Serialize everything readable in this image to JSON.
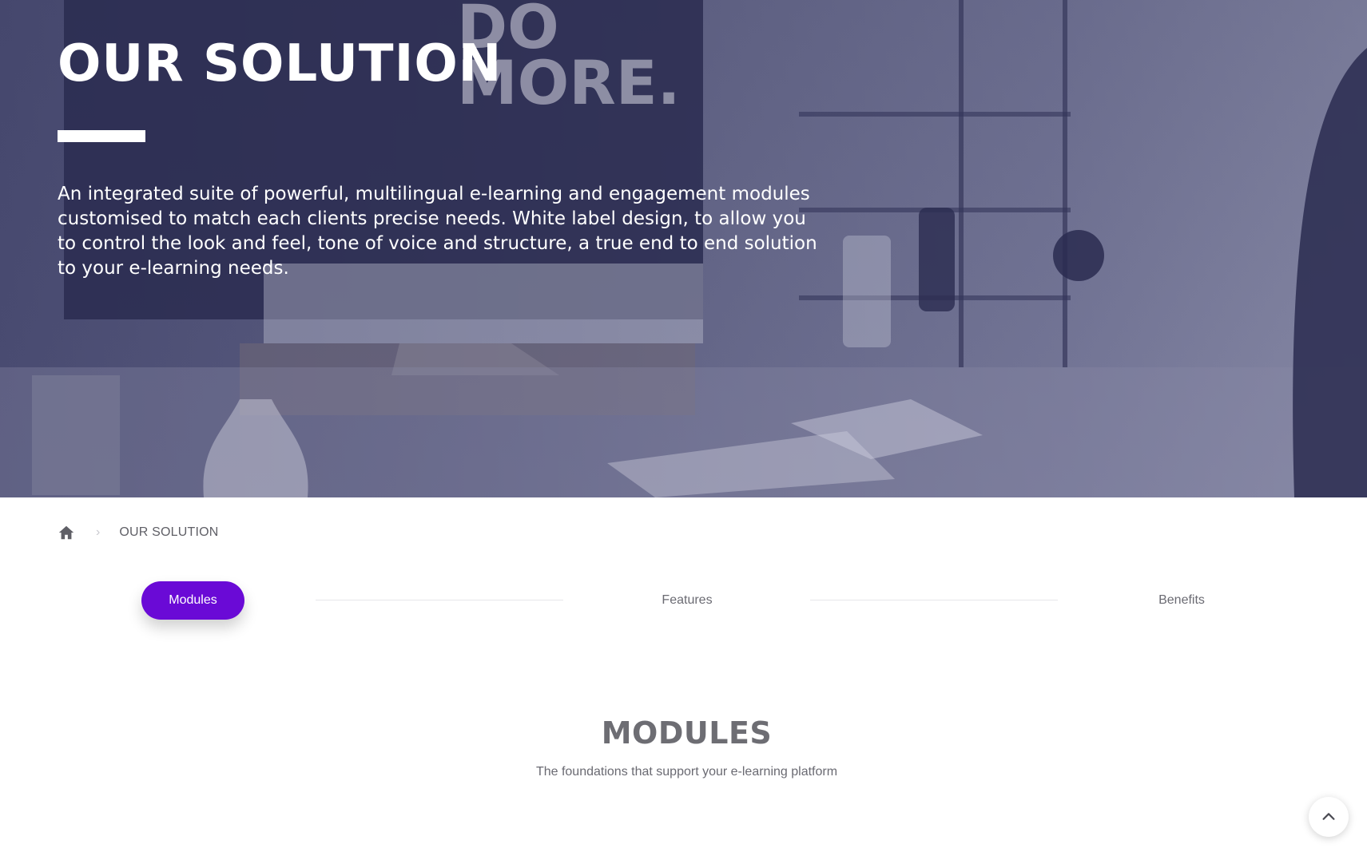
{
  "hero": {
    "title": "OUR SOLUTION",
    "description": "An integrated suite of powerful, multilingual e-learning and engagement modules customised to match each clients precise needs. White label design, to allow you to control the look and feel, tone of voice and structure, a true end to end solution to your e-learning needs.",
    "poster_text": "DO MORE."
  },
  "breadcrumb": {
    "home_icon": "home-icon",
    "separator": "›",
    "current": "OUR SOLUTION"
  },
  "tabs": [
    {
      "label": "Modules",
      "active": true
    },
    {
      "label": "Features",
      "active": false
    },
    {
      "label": "Benefits",
      "active": false
    }
  ],
  "section": {
    "title": "MODULES",
    "subtitle": "The foundations that support your e-learning platform"
  },
  "colors": {
    "accent": "#6a0ad6",
    "hero_overlay": "#2c2e54",
    "text": "#5f5f66"
  },
  "back_to_top_icon": "chevron-up-icon"
}
